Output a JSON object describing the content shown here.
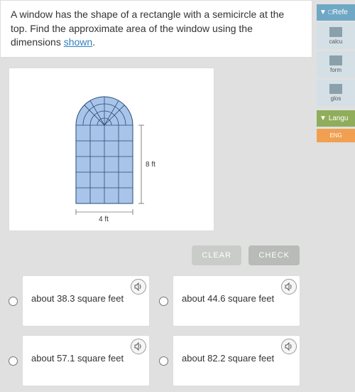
{
  "question": {
    "text_part1": "A window has the shape of a rectangle with a semicircle at the top. Find the approximate area of the window using the dimensions ",
    "link_text": "shown",
    "text_part2": "."
  },
  "figure": {
    "height_label": "8 ft",
    "width_label": "4 ft"
  },
  "buttons": {
    "clear": "CLEAR",
    "check": "CHECK"
  },
  "options": [
    {
      "label": "about 38.3 square feet"
    },
    {
      "label": "about 44.6 square feet"
    },
    {
      "label": "about 57.1 square feet"
    },
    {
      "label": "about 82.2 square feet"
    }
  ],
  "sidebar": {
    "refs_label": "Refe",
    "calc": "calcu",
    "form": "form",
    "glos": "glos",
    "lang_label": "Langu",
    "eng": "ENG"
  }
}
